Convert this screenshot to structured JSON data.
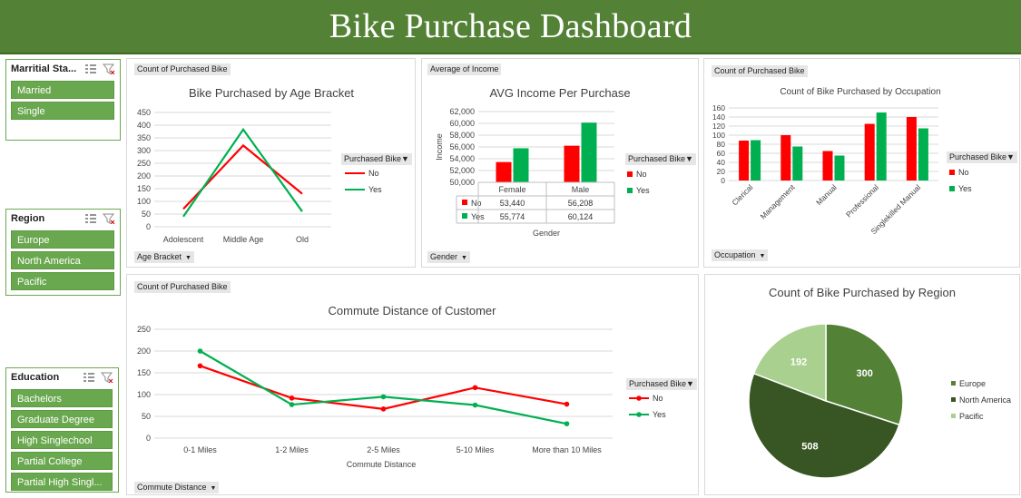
{
  "header": {
    "title": "Bike Purchase Dashboard"
  },
  "slicers": {
    "marital": {
      "title": "Marritial Sta...",
      "items": [
        "Married",
        "Single"
      ]
    },
    "region": {
      "title": "Region",
      "items": [
        "Europe",
        "North America",
        "Pacific"
      ]
    },
    "education": {
      "title": "Education",
      "items": [
        "Bachelors",
        "Graduate Degree",
        "High Singlechool",
        "Partial College",
        "Partial High Singl..."
      ]
    }
  },
  "colors": {
    "no": "#ff0000",
    "yes": "#00b050",
    "europe": "#538135",
    "north_america": "#375623",
    "pacific": "#a9d08e",
    "header": "#538135",
    "slicer": "#6aa84f"
  },
  "panels": {
    "age": {
      "value_field": "Count of Purchased Bike",
      "axis_field": "Age Bracket",
      "legend_field": "Purchased Bike"
    },
    "income": {
      "value_field": "Average of Income",
      "axis_field": "Gender",
      "legend_field": "Purchased Bike"
    },
    "occupation": {
      "value_field": "Count of Purchased Bike",
      "axis_field": "Occupation",
      "legend_field": "Purchased Bike"
    },
    "commute": {
      "value_field": "Count of Purchased Bike",
      "axis_field": "Commute Distance",
      "legend_field": "Purchased Bike"
    }
  },
  "chart_data": [
    {
      "id": "age",
      "type": "line",
      "title": "Bike Purchased by Age Bracket",
      "categories": [
        "Adolescent",
        "Middle Age",
        "Old"
      ],
      "series": [
        {
          "name": "No",
          "values": [
            70,
            320,
            130
          ]
        },
        {
          "name": "Yes",
          "values": [
            40,
            383,
            60
          ]
        }
      ],
      "ylim": [
        0,
        450
      ],
      "yticks": [
        "0",
        "50",
        "100",
        "150",
        "200",
        "250",
        "300",
        "350",
        "400",
        "450"
      ],
      "legend": "right"
    },
    {
      "id": "income",
      "type": "bar",
      "title": "AVG Income Per Purchase",
      "ylabel": "Income",
      "xlabel": "Gender",
      "categories": [
        "Female",
        "Male"
      ],
      "series": [
        {
          "name": "No",
          "values": [
            53440,
            56208
          ],
          "labels": [
            "53,440",
            "56,208"
          ]
        },
        {
          "name": "Yes",
          "values": [
            55774,
            60124
          ],
          "labels": [
            "55,774",
            "60,124"
          ]
        }
      ],
      "ylim": [
        50000,
        62000
      ],
      "yticks": [
        "50,000",
        "52,000",
        "54,000",
        "56,000",
        "58,000",
        "60,000",
        "62,000"
      ],
      "legend": "right"
    },
    {
      "id": "occupation",
      "type": "bar",
      "title": "Count of Bike Purchased by Occupation",
      "categories": [
        "Clerical",
        "Management",
        "Manual",
        "Professional",
        "Singlekilled Manual"
      ],
      "series": [
        {
          "name": "No",
          "values": [
            88,
            100,
            65,
            125,
            140
          ]
        },
        {
          "name": "Yes",
          "values": [
            89,
            75,
            55,
            150,
            115
          ]
        }
      ],
      "ylim": [
        0,
        160
      ],
      "yticks": [
        "0",
        "20",
        "40",
        "60",
        "80",
        "100",
        "120",
        "140",
        "160"
      ],
      "legend": "right"
    },
    {
      "id": "commute",
      "type": "line",
      "title": "Commute Distance of Customer",
      "xlabel": "Commute Distance",
      "categories": [
        "0-1 Miles",
        "1-2 Miles",
        "2-5 Miles",
        "5-10 Miles",
        "More than 10 Miles"
      ],
      "series": [
        {
          "name": "No",
          "values": [
            166,
            92,
            67,
            116,
            78
          ]
        },
        {
          "name": "Yes",
          "values": [
            200,
            77,
            95,
            76,
            33
          ]
        }
      ],
      "ylim": [
        0,
        250
      ],
      "yticks": [
        "0",
        "50",
        "100",
        "150",
        "200",
        "250"
      ],
      "legend": "right"
    },
    {
      "id": "region",
      "type": "pie",
      "title": "Count of Bike Purchased by Region",
      "categories": [
        "Europe",
        "North America",
        "Pacific"
      ],
      "values": [
        300,
        508,
        192
      ],
      "labels": [
        "300",
        "508",
        "192"
      ],
      "legend": "right"
    }
  ]
}
